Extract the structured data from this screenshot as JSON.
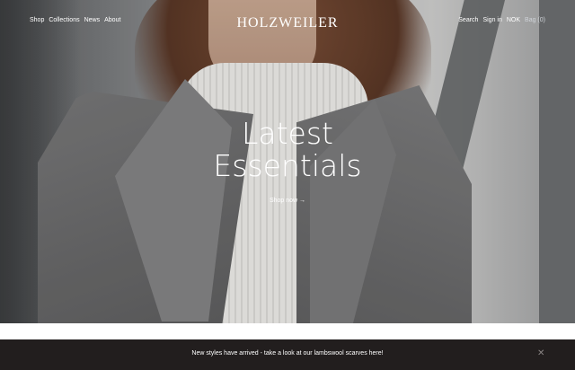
{
  "header": {
    "logo": "HOLZWEILER",
    "nav_left": [
      "Shop",
      "Collections",
      "News",
      "About"
    ],
    "nav_right": {
      "search": "Search",
      "sign_in": "Sign in",
      "currency": "NOK",
      "bag": "Bag (0)"
    }
  },
  "hero": {
    "headline_line1": "Latest",
    "headline_line2": "Essentials",
    "cta": "Shop now →"
  },
  "banner": {
    "message": "New styles have arrived - take a look at our lambswool scarves here!",
    "close_icon": "close-icon"
  }
}
